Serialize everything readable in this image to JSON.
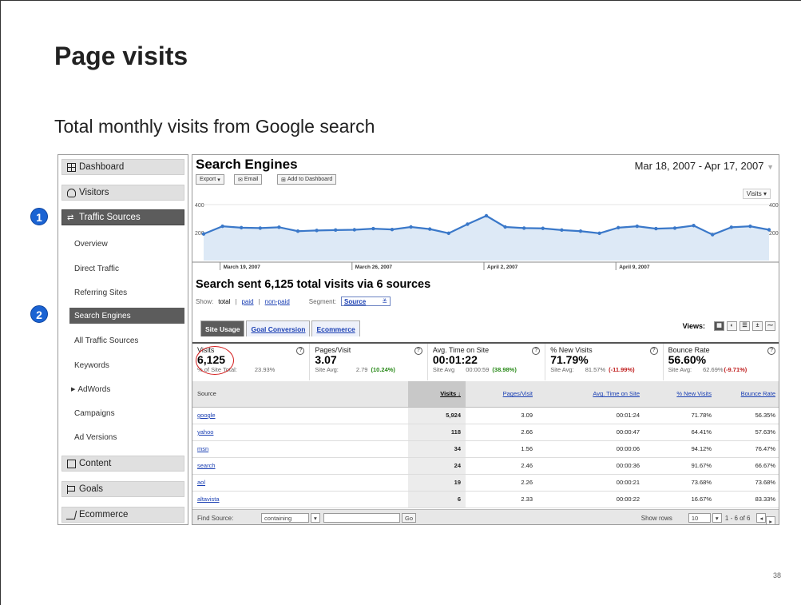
{
  "slide": {
    "title": "Page visits",
    "subtitle": "Total monthly visits from Google search",
    "page_number": "38",
    "callouts": [
      "1",
      "2"
    ]
  },
  "nav": {
    "sections": [
      {
        "label": "Dashboard",
        "icon": "dashboard-grid-icon"
      },
      {
        "label": "Visitors",
        "icon": "person-icon"
      },
      {
        "label": "Traffic Sources",
        "icon": "traffic-arrows-icon",
        "active": true
      },
      {
        "label": "Content",
        "icon": "content-box-icon"
      },
      {
        "label": "Goals",
        "icon": "flag-icon"
      },
      {
        "label": "Ecommerce",
        "icon": "cart-icon"
      }
    ],
    "sub_items": [
      "Overview",
      "Direct Traffic",
      "Referring Sites",
      "Search Engines",
      "All Traffic Sources",
      "Keywords",
      "AdWords",
      "Campaigns",
      "Ad Versions"
    ],
    "active_sub": "Search Engines"
  },
  "main": {
    "title": "Search Engines",
    "date_range": "Mar 18, 2007 - Apr 17, 2007",
    "toolbar": {
      "export": "Export",
      "email": "Email",
      "add_dashboard": "Add to Dashboard"
    },
    "metric_dropdown": "Visits",
    "headline": "Search sent 6,125 total visits via 6 sources",
    "show": {
      "label": "Show:",
      "total": "total",
      "paid": "paid",
      "non_paid": "non-paid",
      "segment_label": "Segment:",
      "segment_value": "Source"
    },
    "tabs": [
      "Site Usage",
      "Goal Conversion",
      "Ecommerce"
    ],
    "views_label": "Views:",
    "summary": [
      {
        "label": "Visits",
        "value": "6,125",
        "avg_label": "% of Site Total:",
        "avg_value": "23.93%",
        "delta": ""
      },
      {
        "label": "Pages/Visit",
        "value": "3.07",
        "avg_label": "Site Avg:",
        "avg_value": "2.79",
        "delta": "(10.24%)"
      },
      {
        "label": "Avg. Time on Site",
        "value": "00:01:22",
        "avg_label": "Site Avg",
        "avg_value": "00:00:59",
        "delta": "(38.98%)"
      },
      {
        "label": "% New Visits",
        "value": "71.79%",
        "avg_label": "Site Avg:",
        "avg_value": "81.57%",
        "delta": "(-11.99%)"
      },
      {
        "label": "Bounce Rate",
        "value": "56.60%",
        "avg_label": "Site Avg:",
        "avg_value": "62.69%",
        "delta": "(-9.71%)"
      }
    ],
    "table": {
      "headers": [
        "Source",
        "Visits",
        "Pages/Visit",
        "Avg. Time on Site",
        "% New Visits",
        "Bounce Rate"
      ],
      "rows": [
        [
          "google",
          "5,924",
          "3.09",
          "00:01:24",
          "71.78%",
          "56.35%"
        ],
        [
          "yahoo",
          "118",
          "2.66",
          "00:00:47",
          "64.41%",
          "57.63%"
        ],
        [
          "msn",
          "34",
          "1.56",
          "00:00:06",
          "94.12%",
          "76.47%"
        ],
        [
          "search",
          "24",
          "2.46",
          "00:00:36",
          "91.67%",
          "66.67%"
        ],
        [
          "aol",
          "19",
          "2.26",
          "00:00:21",
          "73.68%",
          "73.68%"
        ],
        [
          "altavista",
          "6",
          "2.33",
          "00:00:22",
          "16.67%",
          "83.33%"
        ]
      ]
    },
    "footer": {
      "find_label": "Find Source:",
      "match": "containing",
      "go": "Go",
      "show_rows_label": "Show rows",
      "rows_value": "10",
      "range": "1 - 6 of 6"
    }
  },
  "chart_data": {
    "type": "area",
    "x_tick_labels": [
      "March 19, 2007",
      "March 26, 2007",
      "April 2, 2007",
      "April 9, 2007"
    ],
    "y_ticks": [
      200,
      400
    ],
    "ylim": [
      0,
      400
    ],
    "series": [
      {
        "values": [
          190,
          245,
          235,
          232,
          238,
          210,
          215,
          218,
          220,
          228,
          222,
          240,
          225,
          195,
          260,
          320,
          240,
          232,
          230,
          218,
          210,
          195,
          235,
          245,
          228,
          232,
          250,
          185,
          238,
          245,
          220
        ]
      }
    ],
    "color": "#3a78c9",
    "fill": "#dde9f6"
  }
}
